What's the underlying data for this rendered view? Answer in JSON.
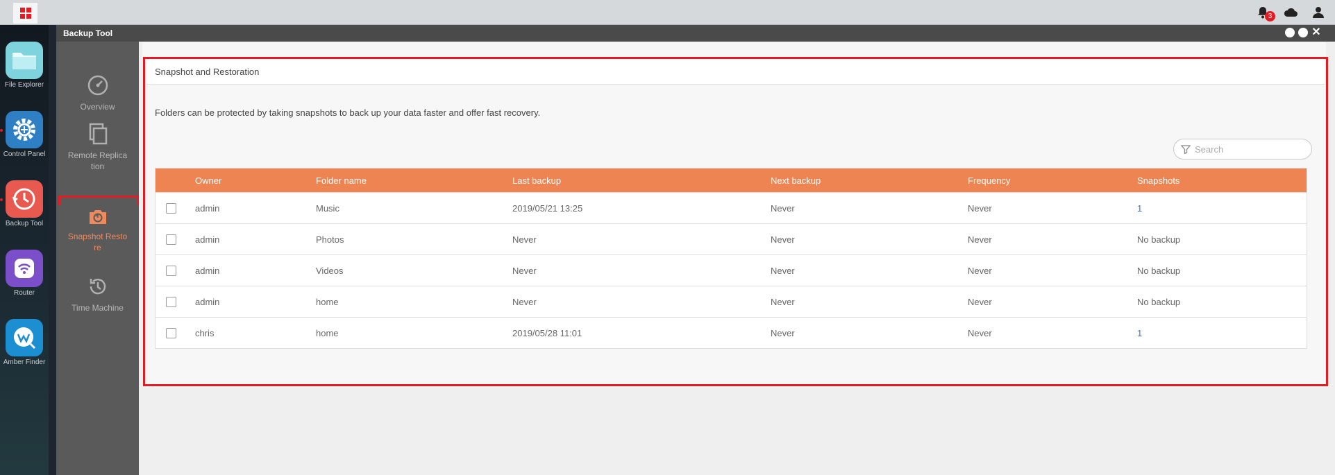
{
  "taskbar": {
    "notification_count": "3"
  },
  "dock": {
    "items": [
      {
        "label": "File Explorer",
        "icon": "folder-icon",
        "color": "#7fd3dc"
      },
      {
        "label": "Control Panel",
        "icon": "gear-icon",
        "color": "#2f7fc5"
      },
      {
        "label": "Backup Tool",
        "icon": "backup-clock-icon",
        "color": "#e85a4f"
      },
      {
        "label": "Router",
        "icon": "wifi-icon",
        "color": "#7b4fc9"
      },
      {
        "label": "Amber Finder",
        "icon": "finder-icon",
        "color": "#1b8fd1"
      }
    ]
  },
  "window": {
    "title": "Backup Tool"
  },
  "sidenav": {
    "items": [
      {
        "label": "Overview",
        "icon": "gauge-icon"
      },
      {
        "label": "Remote Replica tion",
        "icon": "copy-icon"
      },
      {
        "label": "Snapshot Resto re",
        "icon": "camera-icon",
        "active": true
      },
      {
        "label": "Time Machine",
        "icon": "history-icon"
      }
    ]
  },
  "main": {
    "section_title": "Snapshot and Restoration",
    "description": "Folders can be protected by taking snapshots to back up your data faster and offer fast recovery.",
    "search_placeholder": "Search",
    "table": {
      "headers": [
        "Owner",
        "Folder name",
        "Last backup",
        "Next backup",
        "Frequency",
        "Snapshots"
      ],
      "rows": [
        {
          "owner": "admin",
          "folder": "Music",
          "last": "2019/05/21 13:25",
          "next": "Never",
          "freq": "Never",
          "snaps": "1"
        },
        {
          "owner": "admin",
          "folder": "Photos",
          "last": "Never",
          "next": "Never",
          "freq": "Never",
          "snaps": "No backup"
        },
        {
          "owner": "admin",
          "folder": "Videos",
          "last": "Never",
          "next": "Never",
          "freq": "Never",
          "snaps": "No backup"
        },
        {
          "owner": "admin",
          "folder": "home",
          "last": "Never",
          "next": "Never",
          "freq": "Never",
          "snaps": "No backup"
        },
        {
          "owner": "chris",
          "folder": "home",
          "last": "2019/05/28 11:01",
          "next": "Never",
          "freq": "Never",
          "snaps": "1"
        }
      ]
    }
  },
  "colors": {
    "accent": "#ed8452",
    "highlight": "#e31b23",
    "link": "#3a73c4"
  }
}
